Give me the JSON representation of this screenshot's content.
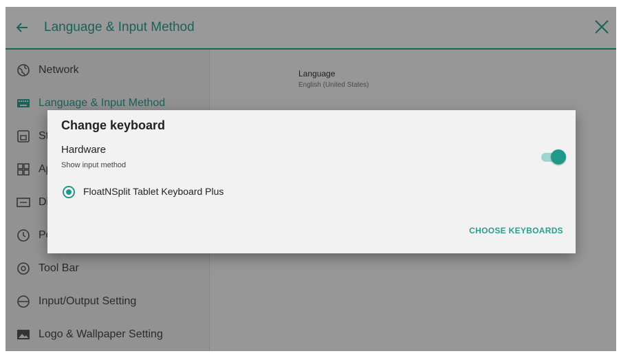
{
  "header": {
    "title": "Language & Input Method"
  },
  "sidebar": {
    "items": [
      {
        "label": "Network",
        "icon": "globe-icon"
      },
      {
        "label": "Language & Input Method",
        "icon": "keyboard-icon",
        "active": true
      },
      {
        "label": "Storage",
        "icon": "storage-icon"
      },
      {
        "label": "Apps",
        "icon": "apps-icon"
      },
      {
        "label": "Display",
        "icon": "display-icon"
      },
      {
        "label": "Power",
        "icon": "clock-icon"
      },
      {
        "label": "Tool Bar",
        "icon": "gear-icon"
      },
      {
        "label": "Input/Output Setting",
        "icon": "io-icon"
      },
      {
        "label": "Logo & Wallpaper Setting",
        "icon": "image-icon"
      }
    ]
  },
  "content": {
    "language_title": "Language",
    "language_value": "English (United States)"
  },
  "dialog": {
    "title": "Change keyboard",
    "hardware_label": "Hardware",
    "hardware_sub": "Show input method",
    "hardware_toggle": true,
    "keyboard_option": "FloatNSplit Tablet Keyboard Plus",
    "choose_button": "CHOOSE KEYBOARDS"
  },
  "colors": {
    "accent": "#2a9d8f",
    "accent_dark": "#1e9a8a"
  }
}
